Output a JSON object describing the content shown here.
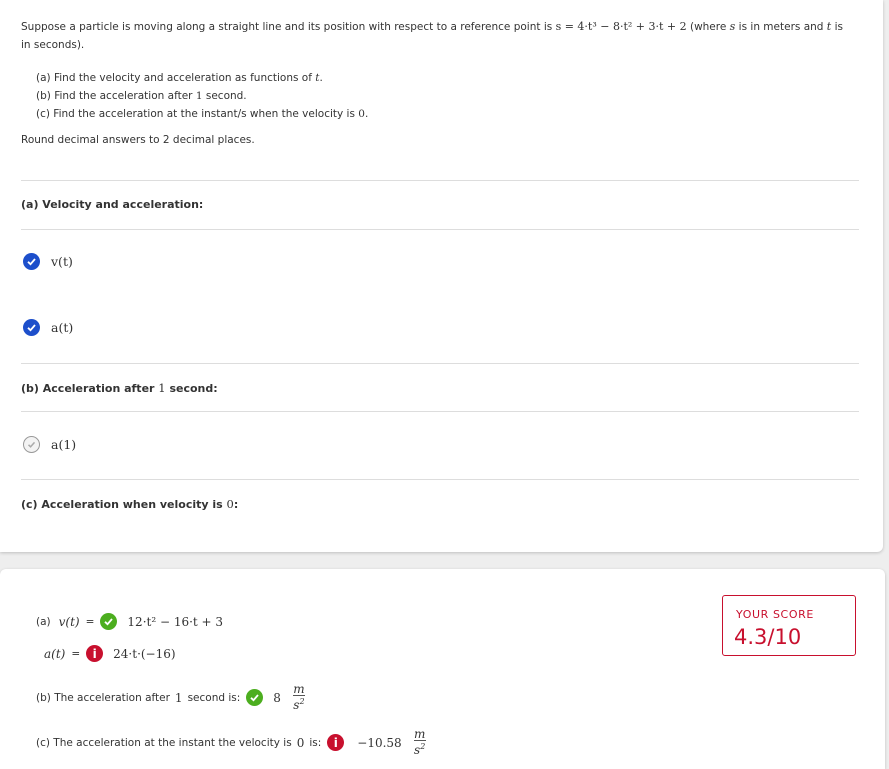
{
  "question": {
    "intro": "Suppose a particle is moving along a straight line and its position with respect to a reference point is",
    "equation": "s = 4·t³ − 8·t² + 3·t + 2",
    "where_prefix": "(where",
    "where_s": "s",
    "where_mid": "is in meters and",
    "where_t": "t",
    "where_suffix": "is",
    "line2": "in seconds).",
    "part_a": "(a) Find the velocity and acceleration as functions of",
    "part_a_var": "t",
    "part_a_end": ".",
    "part_b": "(b) Find the acceleration after",
    "part_b_val": "1",
    "part_b_end": "second.",
    "part_c": "(c) Find the acceleration at the instant/s when the velocity is",
    "part_c_val": "0",
    "part_c_end": ".",
    "rounding": "Round decimal answers to 2 decimal places."
  },
  "sections": {
    "a_title": "(a) Velocity and acceleration:",
    "a_items": [
      "v(t)",
      "a(t)"
    ],
    "b_title_pre": "(b) Acceleration after",
    "b_title_val": "1",
    "b_title_post": "second:",
    "b_item": "a(1)",
    "c_title_pre": "(c) Acceleration when velocity is",
    "c_title_val": "0",
    "c_title_post": ":"
  },
  "results": {
    "a_label": "(a)",
    "v_label": "v(t)",
    "v_value": "12·t² − 16·t + 3",
    "a_fn_label": "a(t)",
    "a_value": "24·t·(−16)",
    "eq": "=",
    "b_text_pre": "(b) The acceleration after",
    "b_text_val": "1",
    "b_text_post": "second is:",
    "b_value": "8",
    "c_text_pre": "(c) The acceleration at the instant the velocity is",
    "c_text_val": "0",
    "c_text_post": "is:",
    "c_value": "−10.58",
    "unit_num": "m",
    "unit_den": "s",
    "unit_exp": "2"
  },
  "score": {
    "label": "YOUR SCORE",
    "value": "4.3/10"
  },
  "icons": {
    "info_glyph": "i"
  },
  "colors": {
    "check_blue": "#1d4fcb",
    "correct_green": "#4cae1f",
    "error_red": "#c8102e"
  }
}
